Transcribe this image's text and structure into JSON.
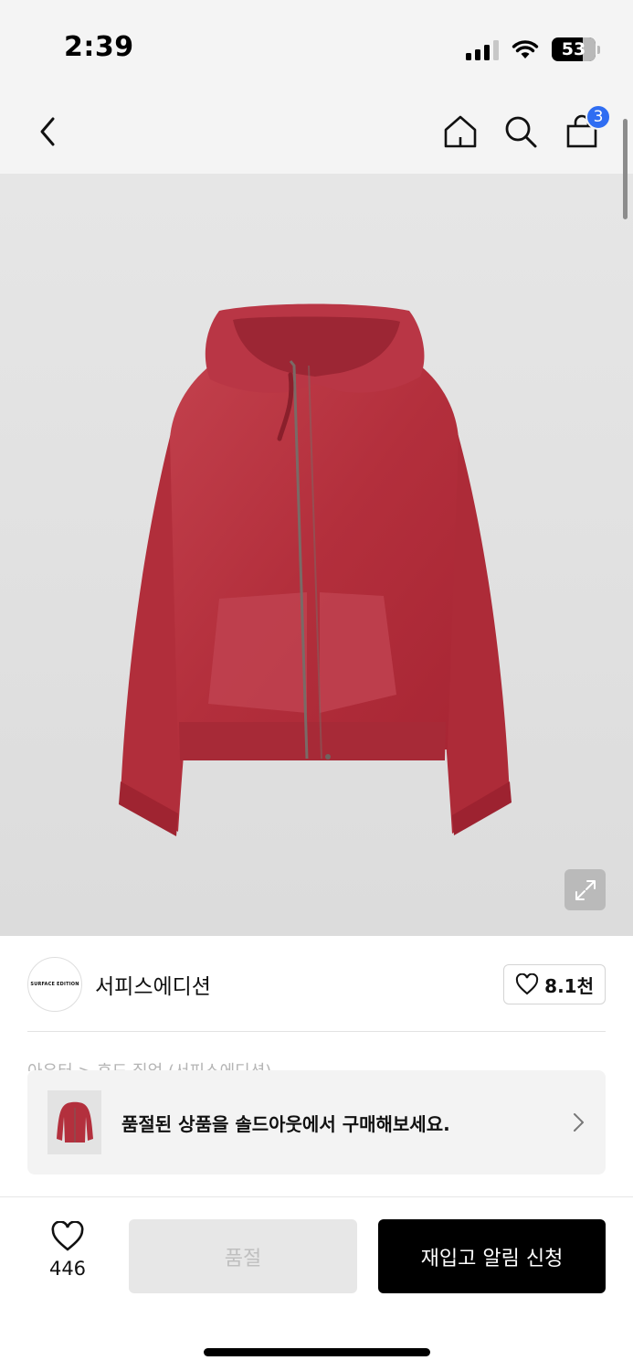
{
  "status_bar": {
    "time": "2:39",
    "battery_level": "53"
  },
  "nav": {
    "back_icon": "chevron-left-icon",
    "home_icon": "home-icon",
    "search_icon": "search-icon",
    "cart_icon": "shopping-bag-icon",
    "cart_count": "3"
  },
  "product": {
    "image_subject": "red zip-up hoodie",
    "expand_icon": "expand-icon"
  },
  "brand": {
    "logo_text": "SURFACE EDITION",
    "name": "서피스에디션",
    "likes": "8.1천"
  },
  "category_peek": "아우터 > 후드 집업 (서피스에디션)",
  "soldout_banner": {
    "text": "품절된 상품을 솔드아웃에서 구매해보세요."
  },
  "bottom_bar": {
    "wish_count": "446",
    "soldout_label": "품절",
    "restock_label": "재입고 알림 신청"
  },
  "colors": {
    "accent_badge": "#2f6df2",
    "hoodie_red": "#b4303d",
    "cta_black": "#000000"
  }
}
